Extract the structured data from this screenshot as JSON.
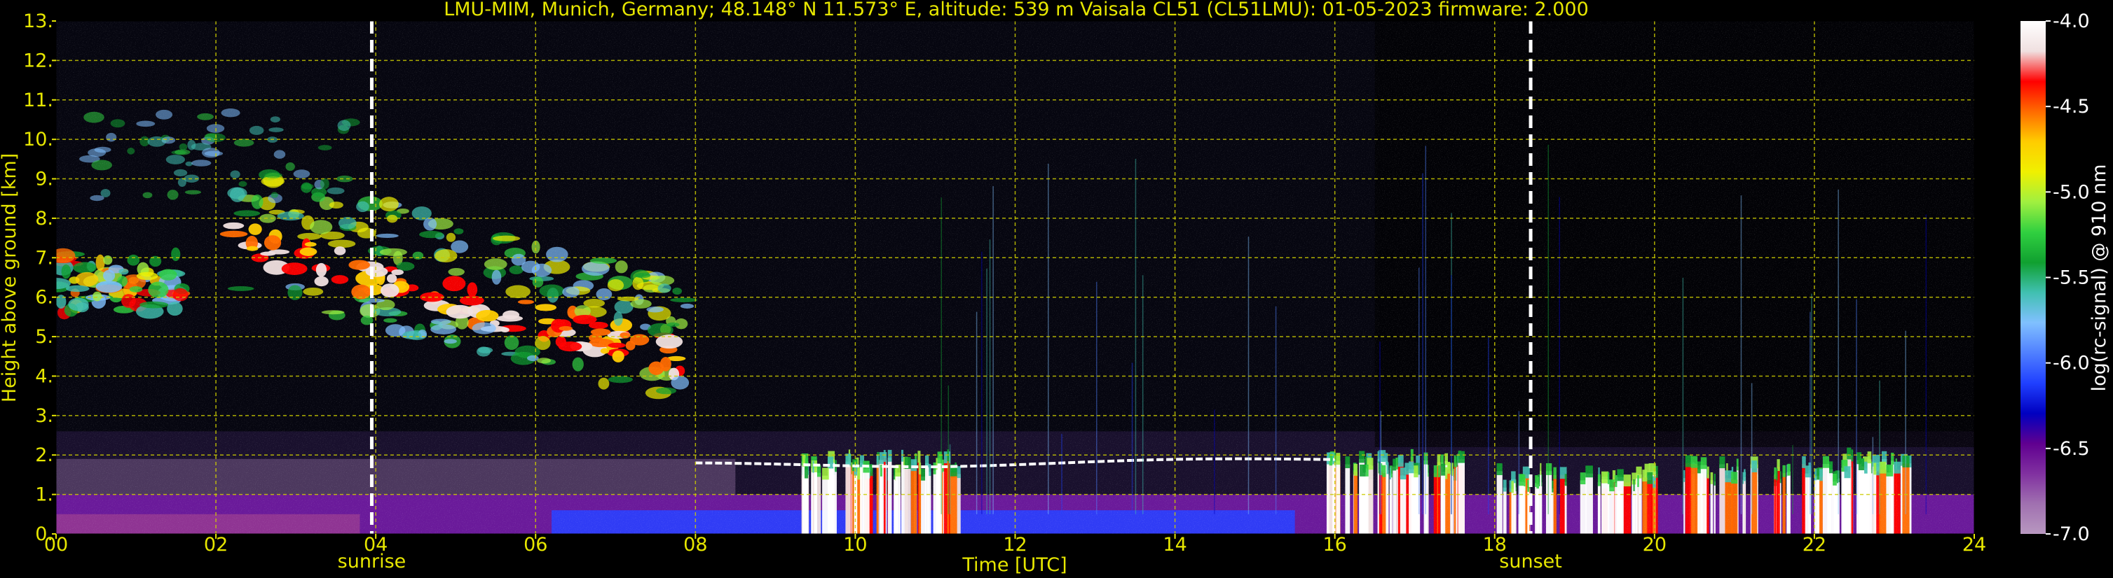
{
  "chart_data": {
    "type": "heatmap",
    "title": "LMU-MIM, Munich, Germany; 48.148° N 11.573° E, altitude: 539 m    Vaisala CL51 (CL51LMU): 01-05-2023    firmware: 2.000",
    "xlabel": "Time [UTC]",
    "ylabel": "Height above ground [km]",
    "xlim": [
      0,
      24
    ],
    "ylim": [
      0,
      13
    ],
    "x_ticks": [
      "00",
      "02",
      "04",
      "06",
      "08",
      "10",
      "12",
      "14",
      "16",
      "18",
      "20",
      "22",
      "24"
    ],
    "y_ticks": [
      "0.",
      "1.",
      "2.",
      "3.",
      "4.",
      "5.",
      "6.",
      "7.",
      "8.",
      "9.",
      "10.",
      "11.",
      "12.",
      "13."
    ],
    "grid": true,
    "annotations": [
      {
        "label": "sunrise",
        "x": 3.95
      },
      {
        "label": "sunset",
        "x": 18.45
      }
    ],
    "colorbar": {
      "label": "log(rc-signal) @ 910 nm",
      "range": [
        -7.0,
        -4.0
      ],
      "ticks": [
        "-4.0",
        "-4.5",
        "-5.0",
        "-5.5",
        "-6.0",
        "-6.5",
        "-7.0"
      ],
      "tick_values": [
        -4.0,
        -4.5,
        -5.0,
        -5.5,
        -6.0,
        -6.5,
        -7.0
      ],
      "colors": [
        "#ffffff",
        "#f0e0e0",
        "#ff0000",
        "#ff6a00",
        "#ffcc00",
        "#f0f000",
        "#a0f040",
        "#30d040",
        "#10a030",
        "#40c0b0",
        "#80c0ff",
        "#5080ff",
        "#2040ff",
        "#0000c0",
        "#600090",
        "#8030a0",
        "#a070b0",
        "#b898c0"
      ]
    },
    "features": [
      {
        "name": "high cloud",
        "t": [
          0.0,
          1.6
        ],
        "h": [
          5.5,
          7.2
        ]
      },
      {
        "name": "cirrus band",
        "t": [
          2.2,
          7.9
        ],
        "h": [
          4.1,
          8.2
        ]
      },
      {
        "name": "boundary layer",
        "t": [
          0.0,
          24.0
        ],
        "h": [
          0.0,
          1.2
        ]
      },
      {
        "name": "low cloud",
        "t": [
          9.3,
          11.3
        ],
        "h": [
          0.0,
          2.0
        ]
      },
      {
        "name": "low cloud",
        "t": [
          15.8,
          23.2
        ],
        "h": [
          0.0,
          2.0
        ]
      }
    ]
  }
}
